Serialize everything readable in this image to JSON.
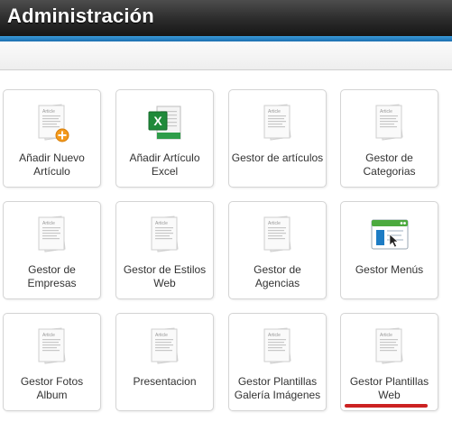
{
  "header": {
    "title": "Administración"
  },
  "colors": {
    "header_bg": "#2b2b2b",
    "accent_stripe": "#1c6fb0",
    "highlight_underline": "#cc2222"
  },
  "tiles": [
    {
      "label": "Añadir Nuevo\nArtículo",
      "icon": "article-add-icon"
    },
    {
      "label": "Añadir Artículo\nExcel",
      "icon": "excel-icon"
    },
    {
      "label": "Gestor de artículos",
      "icon": "article-icon"
    },
    {
      "label": "Gestor de\nCategorias",
      "icon": "article-icon"
    },
    {
      "label": "Gestor de\nEmpresas",
      "icon": "article-icon"
    },
    {
      "label": "Gestor de Estilos\nWeb",
      "icon": "article-icon"
    },
    {
      "label": "Gestor de Agencias",
      "icon": "article-icon"
    },
    {
      "label": "Gestor Menús",
      "icon": "menu-window-icon"
    },
    {
      "label": "Gestor Fotos Album",
      "icon": "article-icon"
    },
    {
      "label": "Presentacion",
      "icon": "article-icon"
    },
    {
      "label": "Gestor Plantillas\nGalería Imágenes",
      "icon": "article-icon"
    },
    {
      "label": "Gestor Plantillas\nWeb",
      "icon": "article-icon"
    }
  ],
  "article_icon_text": "Article"
}
